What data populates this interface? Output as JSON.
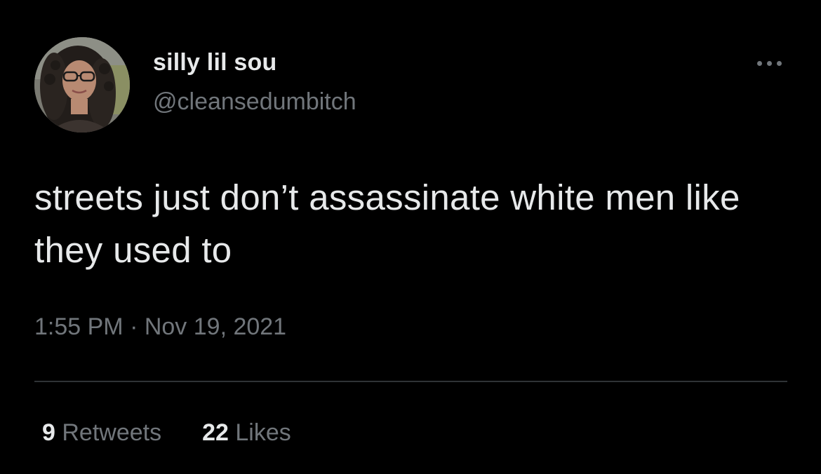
{
  "author": {
    "display_name": "silly lil sou",
    "handle": "@cleansedumbitch"
  },
  "more_icon": "more-horizontal-icon",
  "tweet": {
    "text": "streets just don’t assassinate white men like they used to",
    "timestamp": "1:55 PM · Nov 19, 2021"
  },
  "stats": {
    "retweets_count": "9",
    "retweets_label": "Retweets",
    "likes_count": "22",
    "likes_label": "Likes"
  },
  "colors": {
    "background": "#000000",
    "primary_text": "#e7e9ea",
    "secondary_text": "#71767b",
    "divider": "#2f3336"
  }
}
